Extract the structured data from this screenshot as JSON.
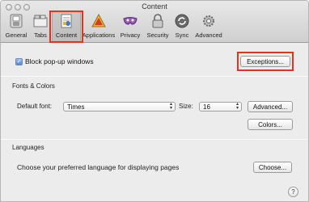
{
  "window": {
    "title": "Content"
  },
  "toolbar": {
    "items": [
      {
        "label": "General",
        "icon": "general-switch-icon"
      },
      {
        "label": "Tabs",
        "icon": "tabs-icon"
      },
      {
        "label": "Content",
        "icon": "content-icon",
        "selected": true
      },
      {
        "label": "Applications",
        "icon": "applications-icon"
      },
      {
        "label": "Privacy",
        "icon": "privacy-mask-icon"
      },
      {
        "label": "Security",
        "icon": "security-lock-icon"
      },
      {
        "label": "Sync",
        "icon": "sync-icon"
      },
      {
        "label": "Advanced",
        "icon": "advanced-gear-icon"
      }
    ]
  },
  "popups": {
    "checkbox_label": "Block pop-up windows",
    "checked": true,
    "exceptions_label": "Exceptions..."
  },
  "fonts": {
    "section_title": "Fonts & Colors",
    "default_font_label": "Default font:",
    "default_font_value": "Times",
    "size_label": "Size:",
    "size_value": "16",
    "advanced_label": "Advanced...",
    "colors_label": "Colors..."
  },
  "languages": {
    "section_title": "Languages",
    "description": "Choose your preferred language for displaying pages",
    "choose_label": "Choose..."
  },
  "help": {
    "label": "?"
  },
  "colors": {
    "highlight": "#e8311b"
  }
}
